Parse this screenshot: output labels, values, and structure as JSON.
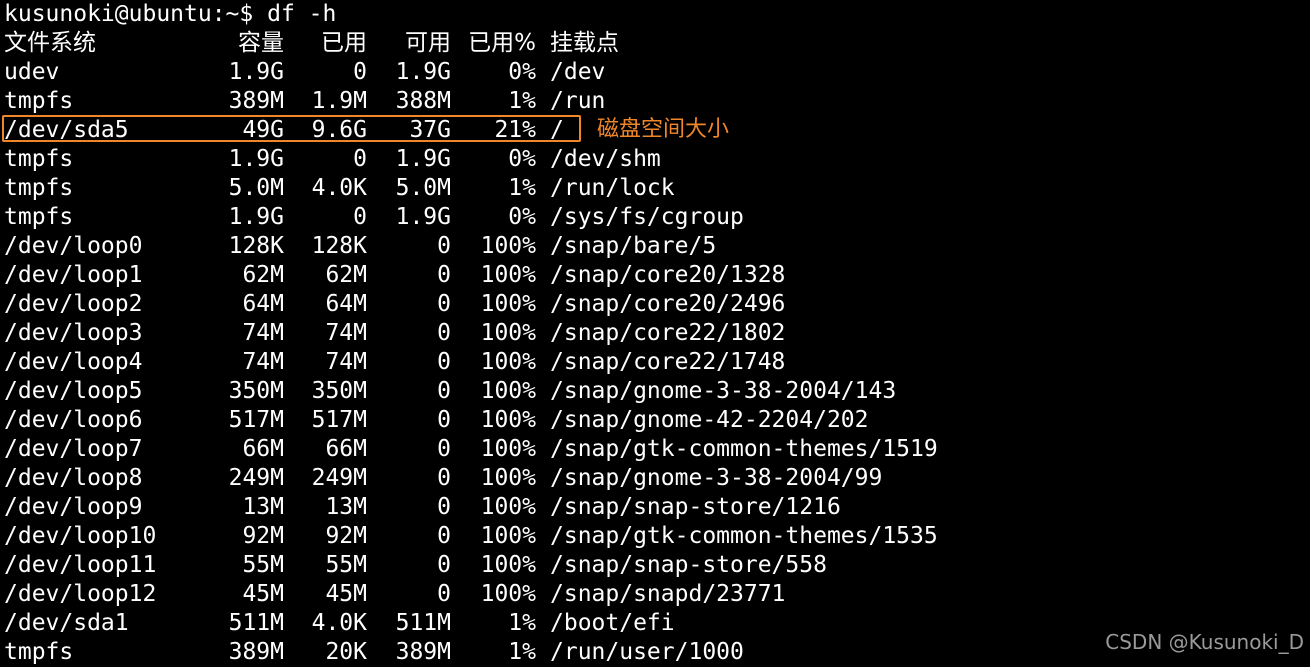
{
  "prompt": {
    "text": "kusunoki@ubuntu:~$ df -h"
  },
  "header": {
    "filesystem": "文件系统",
    "size": "容量",
    "used": "已用",
    "avail": "可用",
    "use_pct": "已用%",
    "mounted_on": "挂载点"
  },
  "rows": [
    {
      "fs": "udev",
      "size": "1.9G",
      "used": "0",
      "avail": "1.9G",
      "pct": "0%",
      "mount": "/dev"
    },
    {
      "fs": "tmpfs",
      "size": "389M",
      "used": "1.9M",
      "avail": "388M",
      "pct": "1%",
      "mount": "/run"
    },
    {
      "fs": "/dev/sda5",
      "size": "49G",
      "used": "9.6G",
      "avail": "37G",
      "pct": "21%",
      "mount": "/"
    },
    {
      "fs": "tmpfs",
      "size": "1.9G",
      "used": "0",
      "avail": "1.9G",
      "pct": "0%",
      "mount": "/dev/shm"
    },
    {
      "fs": "tmpfs",
      "size": "5.0M",
      "used": "4.0K",
      "avail": "5.0M",
      "pct": "1%",
      "mount": "/run/lock"
    },
    {
      "fs": "tmpfs",
      "size": "1.9G",
      "used": "0",
      "avail": "1.9G",
      "pct": "0%",
      "mount": "/sys/fs/cgroup"
    },
    {
      "fs": "/dev/loop0",
      "size": "128K",
      "used": "128K",
      "avail": "0",
      "pct": "100%",
      "mount": "/snap/bare/5"
    },
    {
      "fs": "/dev/loop1",
      "size": "62M",
      "used": "62M",
      "avail": "0",
      "pct": "100%",
      "mount": "/snap/core20/1328"
    },
    {
      "fs": "/dev/loop2",
      "size": "64M",
      "used": "64M",
      "avail": "0",
      "pct": "100%",
      "mount": "/snap/core20/2496"
    },
    {
      "fs": "/dev/loop3",
      "size": "74M",
      "used": "74M",
      "avail": "0",
      "pct": "100%",
      "mount": "/snap/core22/1802"
    },
    {
      "fs": "/dev/loop4",
      "size": "74M",
      "used": "74M",
      "avail": "0",
      "pct": "100%",
      "mount": "/snap/core22/1748"
    },
    {
      "fs": "/dev/loop5",
      "size": "350M",
      "used": "350M",
      "avail": "0",
      "pct": "100%",
      "mount": "/snap/gnome-3-38-2004/143"
    },
    {
      "fs": "/dev/loop6",
      "size": "517M",
      "used": "517M",
      "avail": "0",
      "pct": "100%",
      "mount": "/snap/gnome-42-2204/202"
    },
    {
      "fs": "/dev/loop7",
      "size": "66M",
      "used": "66M",
      "avail": "0",
      "pct": "100%",
      "mount": "/snap/gtk-common-themes/1519"
    },
    {
      "fs": "/dev/loop8",
      "size": "249M",
      "used": "249M",
      "avail": "0",
      "pct": "100%",
      "mount": "/snap/gnome-3-38-2004/99"
    },
    {
      "fs": "/dev/loop9",
      "size": "13M",
      "used": "13M",
      "avail": "0",
      "pct": "100%",
      "mount": "/snap/snap-store/1216"
    },
    {
      "fs": "/dev/loop10",
      "size": "92M",
      "used": "92M",
      "avail": "0",
      "pct": "100%",
      "mount": "/snap/gtk-common-themes/1535"
    },
    {
      "fs": "/dev/loop11",
      "size": "55M",
      "used": "55M",
      "avail": "0",
      "pct": "100%",
      "mount": "/snap/snap-store/558"
    },
    {
      "fs": "/dev/loop12",
      "size": "45M",
      "used": "45M",
      "avail": "0",
      "pct": "100%",
      "mount": "/snap/snapd/23771"
    },
    {
      "fs": "/dev/sda1",
      "size": "511M",
      "used": "4.0K",
      "avail": "511M",
      "pct": "1%",
      "mount": "/boot/efi"
    },
    {
      "fs": "tmpfs",
      "size": "389M",
      "used": "20K",
      "avail": "389M",
      "pct": "1%",
      "mount": "/run/user/1000"
    }
  ],
  "annotation": {
    "text": "磁盘空间大小",
    "color": "#f0862a"
  },
  "watermark": {
    "text": "CSDN @Kusunoki_D"
  },
  "colors": {
    "background": "#000000",
    "foreground": "#ffffff",
    "highlight": "#f0862a"
  }
}
